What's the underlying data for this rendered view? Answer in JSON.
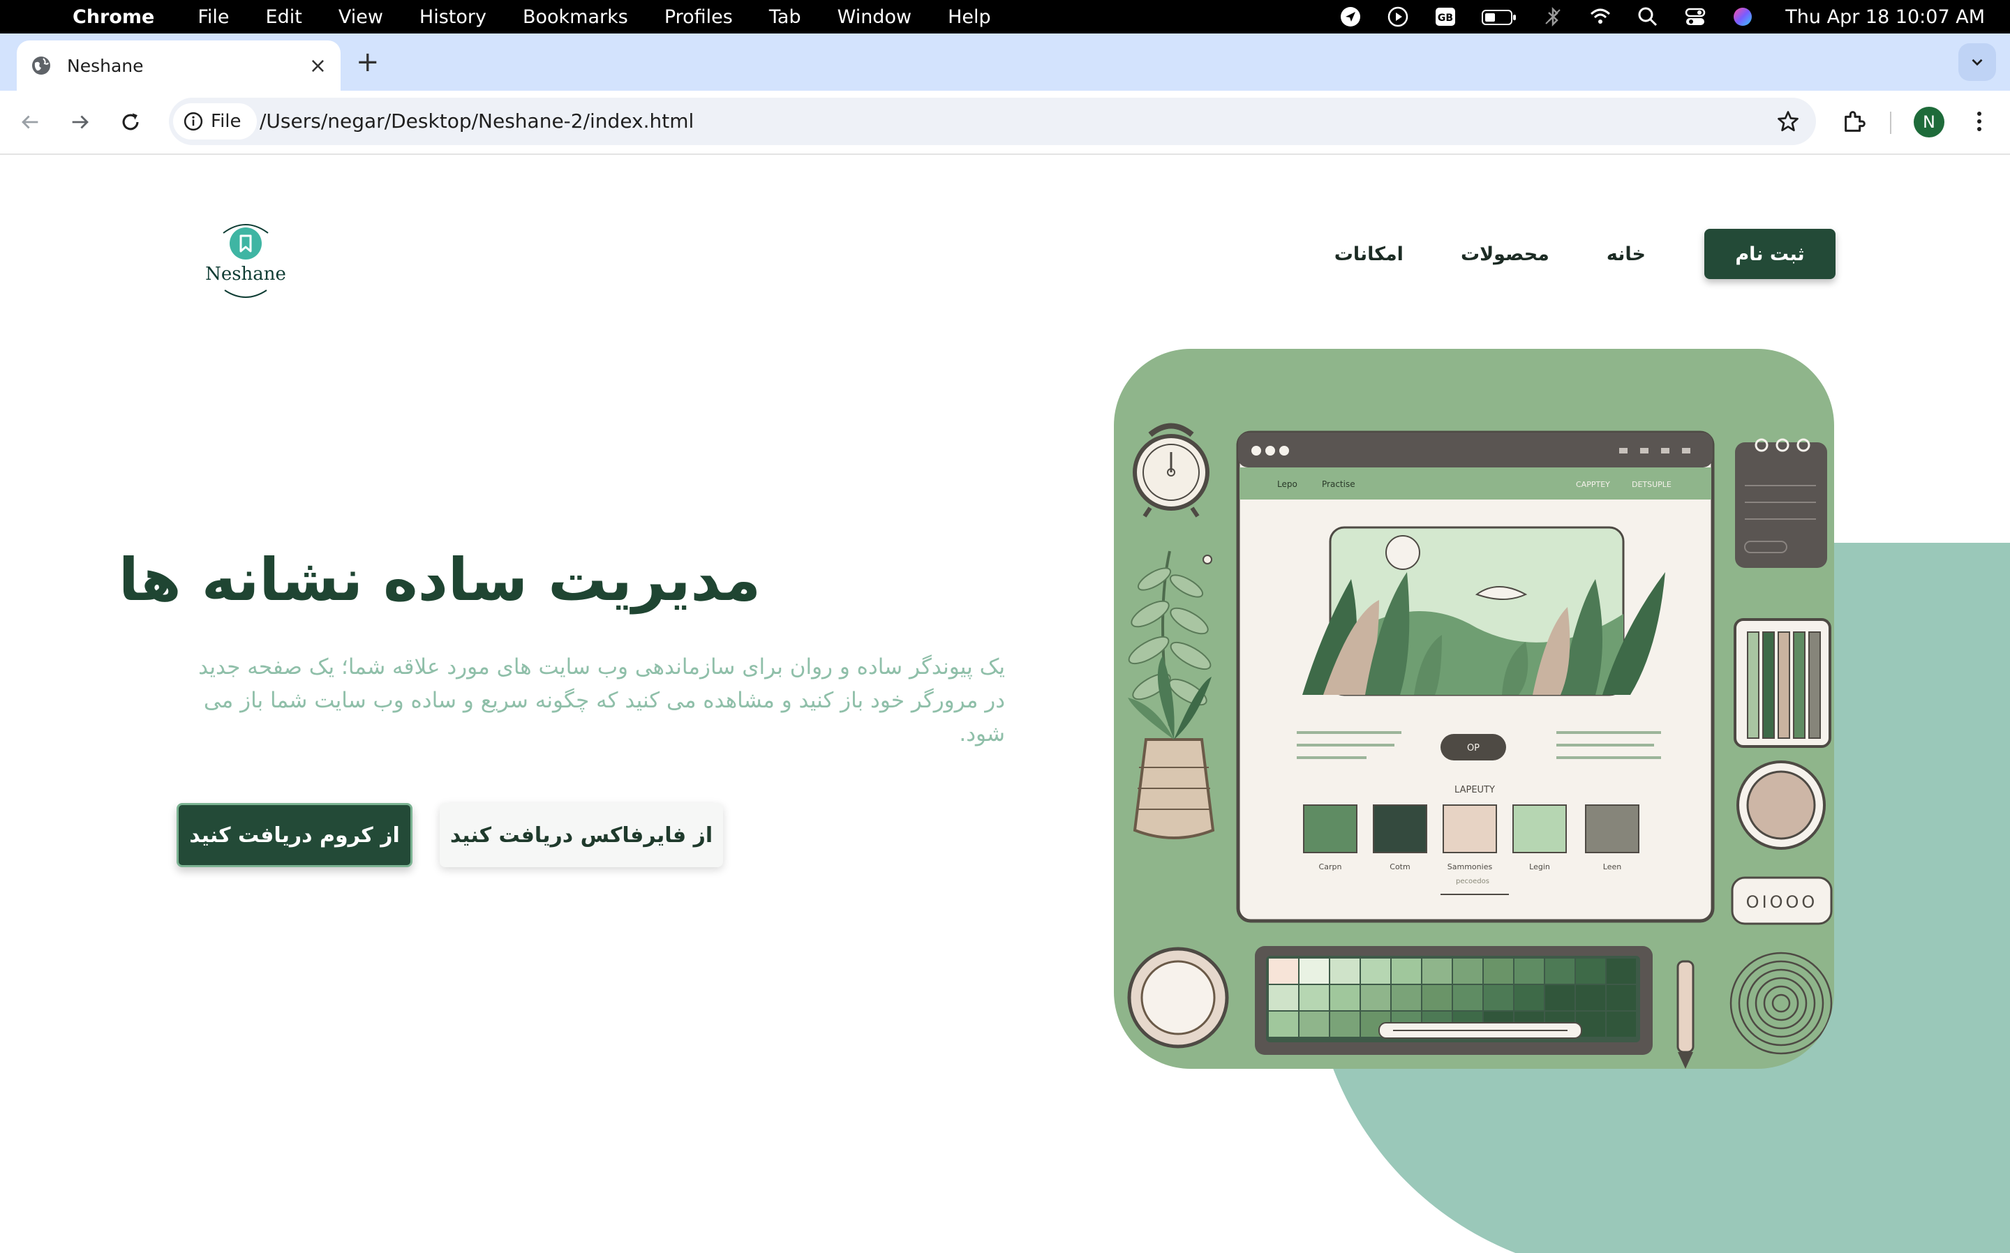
{
  "menubar": {
    "app_name": "Chrome",
    "items": [
      "File",
      "Edit",
      "View",
      "History",
      "Bookmarks",
      "Profiles",
      "Tab",
      "Window",
      "Help"
    ],
    "clock": "Thu Apr 18  10:07 AM",
    "status_icons": [
      "location-icon",
      "play-icon",
      "keyboard-layout-icon",
      "battery-icon",
      "bluetooth-icon",
      "wifi-icon",
      "spotlight-icon",
      "control-center-icon",
      "siri-icon"
    ],
    "keyboard_layout": "GB"
  },
  "browser": {
    "tab_title": "Neshane",
    "new_tab_label": "+",
    "close_label": "×",
    "chip_label": "File",
    "url": "/Users/negar/Desktop/Neshane-2/index.html",
    "profile_initial": "N"
  },
  "site": {
    "logo_text": "Neshane",
    "nav": {
      "signup": "ثبت نام",
      "home": "خانه",
      "products": "محصولات",
      "features": "امکانات"
    },
    "hero": {
      "title": "مدیریت ساده نشانه ها",
      "description": "یک پیوندگر ساده و روان برای سازماندهی وب سایت های مورد علاقه شما؛ یک صفحه جدید در مرورگر خود باز کنید و مشاهده می کنید که چگونه سریع و ساده وب سایت شما باز می شود.",
      "btn_chrome": "از کروم دریافت کنید",
      "btn_firefox": "از فایرفاکس دریافت کنید"
    },
    "illustration": {
      "nav_left": [
        "Lepo",
        "Practise"
      ],
      "nav_right": [
        "CAPPTEY",
        "DETSUPLE"
      ],
      "pill": "OP",
      "palette_title": "LAPEUTY",
      "swatch_labels": [
        "Carpn",
        "Cotm",
        "Sammonies",
        "Legin",
        "Leen"
      ],
      "swatch_sublabel": "pecoedos",
      "badge": "OIOOO"
    },
    "colors": {
      "primary": "#234a37",
      "accent": "#8fbfa9",
      "deco": "#9ac8b9",
      "illustration_bg": "#8fb58b"
    }
  }
}
